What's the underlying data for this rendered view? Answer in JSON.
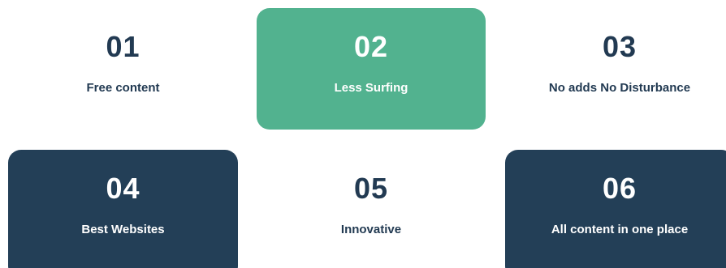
{
  "colors": {
    "accent_green": "#52b28f",
    "dark_navy": "#233f57",
    "text_navy": "#223a52",
    "background": "#ffffff"
  },
  "features": [
    {
      "number": "01",
      "label": "Free content"
    },
    {
      "number": "02",
      "label": "Less Surfing"
    },
    {
      "number": "03",
      "label": "No adds No Disturbance"
    },
    {
      "number": "04",
      "label": "Best Websites"
    },
    {
      "number": "05",
      "label": "Innovative"
    },
    {
      "number": "06",
      "label": "All content in one place"
    }
  ]
}
